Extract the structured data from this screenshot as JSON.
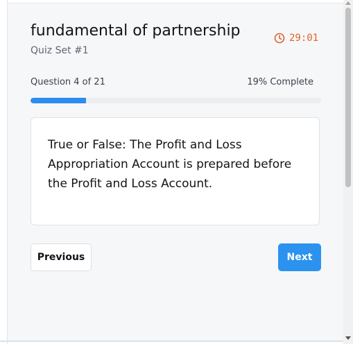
{
  "quiz": {
    "title": "fundamental of partnership",
    "subtitle": "Quiz Set #1",
    "timer": "29:01",
    "timer_icon": "clock-icon"
  },
  "progress": {
    "label": "Question 4 of 21",
    "status": "19% Complete",
    "fraction": 0.19
  },
  "question": {
    "text": "True or False: The Profit and Loss Appropriation Account is prepared before the Profit and Loss Account."
  },
  "navigation": {
    "previous_label": "Previous",
    "next_label": "Next"
  },
  "colors": {
    "accent": "#2b93ef",
    "timer": "#e0622a"
  }
}
